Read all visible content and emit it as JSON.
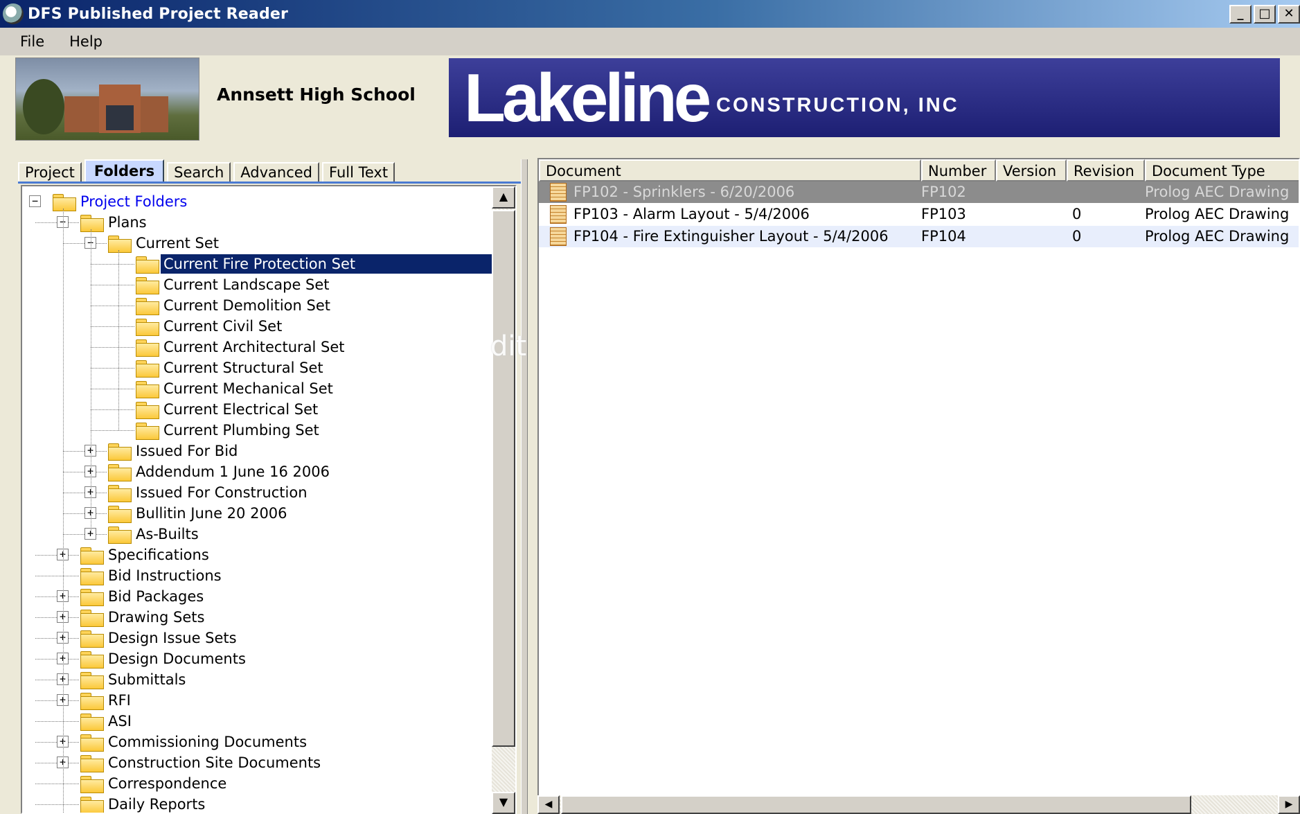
{
  "window": {
    "title": "DFS Published Project Reader",
    "buttons": [
      "_",
      "□",
      "✕"
    ]
  },
  "menu": [
    "File",
    "Help"
  ],
  "header": {
    "school_name": "Annsett High School",
    "logo_big": "Lakeline",
    "logo_small": "CONSTRUCTION, INC"
  },
  "tabs": [
    {
      "label": "Project",
      "active": false
    },
    {
      "label": "Folders",
      "active": true
    },
    {
      "label": "Search",
      "active": false
    },
    {
      "label": "Advanced",
      "active": false
    },
    {
      "label": "Full Text",
      "active": false
    }
  ],
  "tree": [
    {
      "label": "Project Folders",
      "level": 0,
      "expander": "-",
      "root": true
    },
    {
      "label": "Plans",
      "level": 1,
      "expander": "-"
    },
    {
      "label": "Current Set",
      "level": 2,
      "expander": "-"
    },
    {
      "label": "Current Fire Protection Set",
      "level": 3,
      "expander": "",
      "selected": true
    },
    {
      "label": "Current Landscape Set",
      "level": 3,
      "expander": ""
    },
    {
      "label": "Current Demolition Set",
      "level": 3,
      "expander": ""
    },
    {
      "label": "Current Civil Set",
      "level": 3,
      "expander": ""
    },
    {
      "label": "Current Architectural Set",
      "level": 3,
      "expander": ""
    },
    {
      "label": "Current Structural Set",
      "level": 3,
      "expander": ""
    },
    {
      "label": "Current Mechanical Set",
      "level": 3,
      "expander": ""
    },
    {
      "label": "Current Electrical Set",
      "level": 3,
      "expander": ""
    },
    {
      "label": "Current Plumbing Set",
      "level": 3,
      "expander": ""
    },
    {
      "label": "Issued For Bid",
      "level": 2,
      "expander": "+"
    },
    {
      "label": "Addendum 1 June 16 2006",
      "level": 2,
      "expander": "+"
    },
    {
      "label": "Issued For Construction",
      "level": 2,
      "expander": "+"
    },
    {
      "label": "Bullitin June 20 2006",
      "level": 2,
      "expander": "+"
    },
    {
      "label": "As-Builts",
      "level": 2,
      "expander": "+"
    },
    {
      "label": "Specifications",
      "level": 1,
      "expander": "+"
    },
    {
      "label": "Bid Instructions",
      "level": 1,
      "expander": ""
    },
    {
      "label": "Bid Packages",
      "level": 1,
      "expander": "+"
    },
    {
      "label": "Drawing Sets",
      "level": 1,
      "expander": "+"
    },
    {
      "label": "Design Issue Sets",
      "level": 1,
      "expander": "+"
    },
    {
      "label": "Design Documents",
      "level": 1,
      "expander": "+"
    },
    {
      "label": "Submittals",
      "level": 1,
      "expander": "+"
    },
    {
      "label": "RFI",
      "level": 1,
      "expander": "+"
    },
    {
      "label": "ASI",
      "level": 1,
      "expander": ""
    },
    {
      "label": "Commissioning Documents",
      "level": 1,
      "expander": "+"
    },
    {
      "label": "Construction Site Documents",
      "level": 1,
      "expander": "+"
    },
    {
      "label": "Correspondence",
      "level": 1,
      "expander": ""
    },
    {
      "label": "Daily Reports",
      "level": 1,
      "expander": ""
    }
  ],
  "documents": {
    "columns": [
      "Document",
      "Number",
      "Version",
      "Revision",
      "Document Type"
    ],
    "rows": [
      {
        "document": "FP102 - Sprinklers - 6/20/2006",
        "number": "FP102",
        "version": "",
        "revision": "",
        "type": "Prolog AEC Drawing",
        "state": "disabled"
      },
      {
        "document": "FP103 - Alarm Layout - 5/4/2006",
        "number": "FP103",
        "version": "",
        "revision": "0",
        "type": "Prolog AEC Drawing",
        "state": "normal"
      },
      {
        "document": "FP104 - Fire Extinguisher Layout - 5/4/2006",
        "number": "FP104",
        "version": "",
        "revision": "0",
        "type": "Prolog AEC Drawing",
        "state": "alt"
      }
    ]
  },
  "overlay_text": "dit",
  "colors": {
    "title_bar": "#0a246a",
    "selection": "#0a246a",
    "logo_bg": "#2a2c80",
    "root_link": "#0000ee",
    "disabled_row": "#8c8c8c"
  }
}
